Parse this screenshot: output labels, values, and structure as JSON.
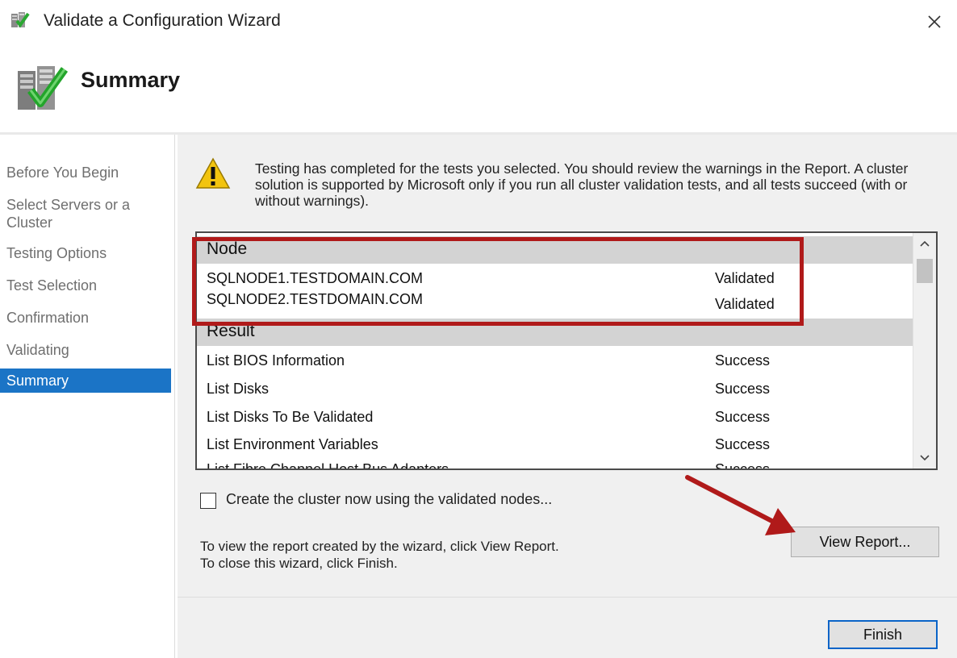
{
  "window": {
    "title": "Validate a Configuration Wizard"
  },
  "header": {
    "title": "Summary"
  },
  "nav": {
    "items": [
      {
        "label": "Before You Begin"
      },
      {
        "label": "Select Servers or a Cluster"
      },
      {
        "label": "Testing Options"
      },
      {
        "label": "Test Selection"
      },
      {
        "label": "Confirmation"
      },
      {
        "label": "Validating"
      },
      {
        "label": "Summary"
      }
    ]
  },
  "content": {
    "message": "Testing has completed for the tests you selected. You should review the warnings in the Report.  A cluster solution is supported by Microsoft only if you run all cluster validation tests, and all tests succeed (with or without warnings).",
    "list": {
      "node_header": "Node",
      "nodes": [
        {
          "name": "SQLNODE1.TESTDOMAIN.COM",
          "status": "Validated"
        },
        {
          "name": "SQLNODE2.TESTDOMAIN.COM",
          "status": "Validated"
        }
      ],
      "result_header": "Result",
      "results": [
        {
          "name": "List BIOS Information",
          "status": "Success"
        },
        {
          "name": "List Disks",
          "status": "Success"
        },
        {
          "name": "List Disks To Be Validated",
          "status": "Success"
        },
        {
          "name": "List Environment Variables",
          "status": "Success"
        },
        {
          "name": "List Fibre Channel Host Bus Adapters",
          "status": "Success"
        }
      ]
    },
    "checkbox_label": "Create the cluster now using the validated nodes...",
    "info_line1": "To view the report created by the wizard, click View Report.",
    "info_line2": "To close this wizard, click Finish.",
    "view_report_label": "View Report...",
    "finish_label": "Finish"
  },
  "colors": {
    "highlight": "#b01a1a",
    "nav_active": "#1b74c6"
  }
}
